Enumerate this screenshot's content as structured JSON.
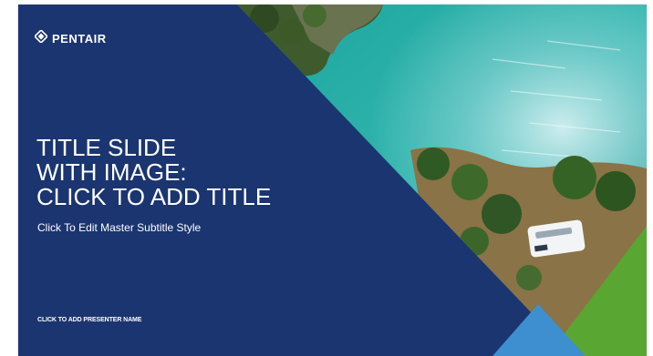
{
  "slide": {
    "logo": {
      "text": "PENTAIR",
      "icon": "pentair-diamond-logo-icon"
    },
    "title_lines": [
      "TITLE SLIDE",
      "WITH IMAGE:",
      "CLICK TO ADD TITLE"
    ],
    "subtitle": "Click To Edit Master Subtitle Style",
    "presenter": "CLICK TO ADD PRESENTER NAME",
    "image": {
      "subject": "aerial-coastline-with-camper-van"
    }
  },
  "colors": {
    "navy": "#1b3570",
    "green": "#5aa632",
    "light_blue": "#3d8fd0",
    "sea": "#1fa5a3",
    "frame": "#ffffff"
  }
}
